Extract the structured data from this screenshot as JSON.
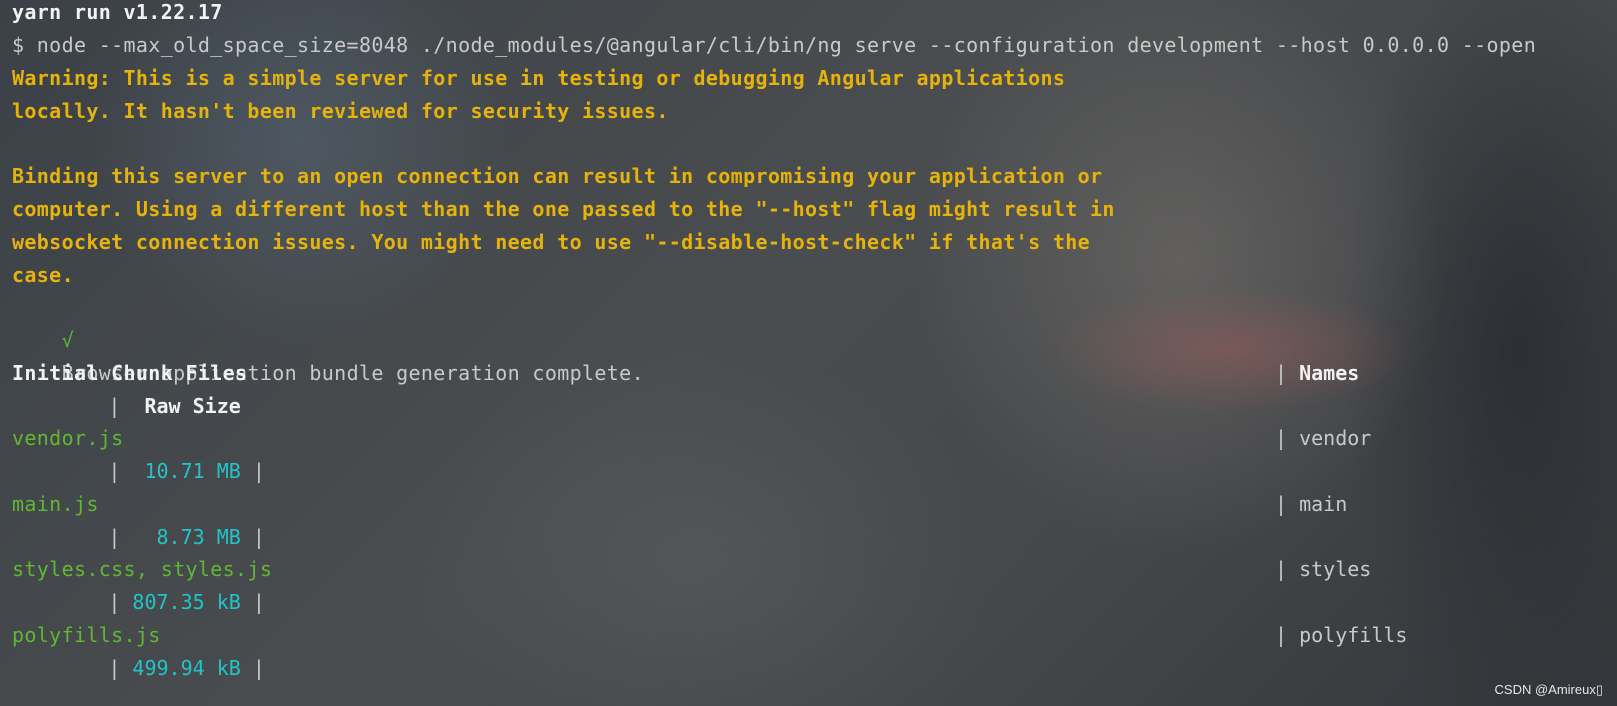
{
  "terminal": {
    "header": "yarn run v1.22.17",
    "command": "$ node --max_old_space_size=8048 ./node_modules/@angular/cli/bin/ng serve --configuration development --host 0.0.0.0 --open",
    "warning_lines": [
      "Warning: This is a simple server for use in testing or debugging Angular applications",
      "locally. It hasn't been reviewed for security issues.",
      "",
      "Binding this server to an open connection can result in compromising your application or",
      "computer. Using a different host than the one passed to the \"--host\" flag might result in",
      "websocket connection issues. You might need to use \"--disable-host-check\" if that's the",
      "case."
    ],
    "success_mark": "√",
    "success_text": "Browser application bundle generation complete.",
    "table": {
      "header_files": "Initial Chunk Files",
      "header_names": "Names",
      "header_size": "Raw Size",
      "rows": [
        {
          "file": "vendor.js",
          "name": "vendor",
          "size": "10.71 MB"
        },
        {
          "file": "main.js",
          "name": "main",
          "size": "8.73 MB"
        },
        {
          "file": "styles.css, styles.js",
          "name": "styles",
          "size": "807.35 kB"
        },
        {
          "file": "polyfills.js",
          "name": "polyfills",
          "size": "499.94 kB"
        }
      ]
    }
  },
  "watermark": "CSDN @Amireux▯"
}
